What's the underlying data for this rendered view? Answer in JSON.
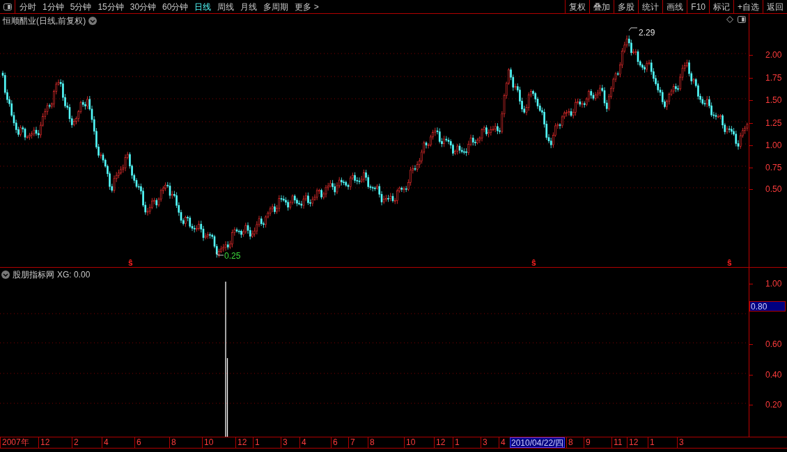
{
  "toolbar": {
    "periods": [
      {
        "label": "分时",
        "selected": false
      },
      {
        "label": "1分钟",
        "selected": false
      },
      {
        "label": "5分钟",
        "selected": false
      },
      {
        "label": "15分钟",
        "selected": false
      },
      {
        "label": "30分钟",
        "selected": false
      },
      {
        "label": "60分钟",
        "selected": false
      },
      {
        "label": "日线",
        "selected": true
      },
      {
        "label": "周线",
        "selected": false
      },
      {
        "label": "月线",
        "selected": false
      },
      {
        "label": "多周期",
        "selected": false
      },
      {
        "label": "更多 >",
        "selected": false
      }
    ],
    "actions": [
      "复权",
      "叠加",
      "多股",
      "统计",
      "画线",
      "F10",
      "标记",
      "+自选",
      "返回"
    ]
  },
  "price_chart": {
    "title": "恒顺醋业(日线,前复权)",
    "high_label": "2.29",
    "low_label": "0.25",
    "signals": [
      "ŝ",
      "ŝ",
      "ŝ"
    ],
    "y_axis": [
      "2.00",
      "1.75",
      "1.50",
      "1.25",
      "1.00",
      "0.75",
      "0.50"
    ]
  },
  "indicator": {
    "name": "股朋指标网",
    "value": "XG: 0.00",
    "y_axis": [
      "1.00",
      "0.60",
      "0.40",
      "0.20"
    ],
    "cursor_value": "0.80"
  },
  "time_axis": {
    "labels": [
      "2007年",
      "12",
      "2",
      "4",
      "6",
      "8",
      "10",
      "12",
      "1",
      "3",
      "4",
      "6",
      "7",
      "8",
      "10",
      "12",
      "1",
      "3",
      "4",
      "8",
      "9",
      "11",
      "12",
      "1",
      "3"
    ],
    "cursor_date": "2010/04/22/四"
  }
}
